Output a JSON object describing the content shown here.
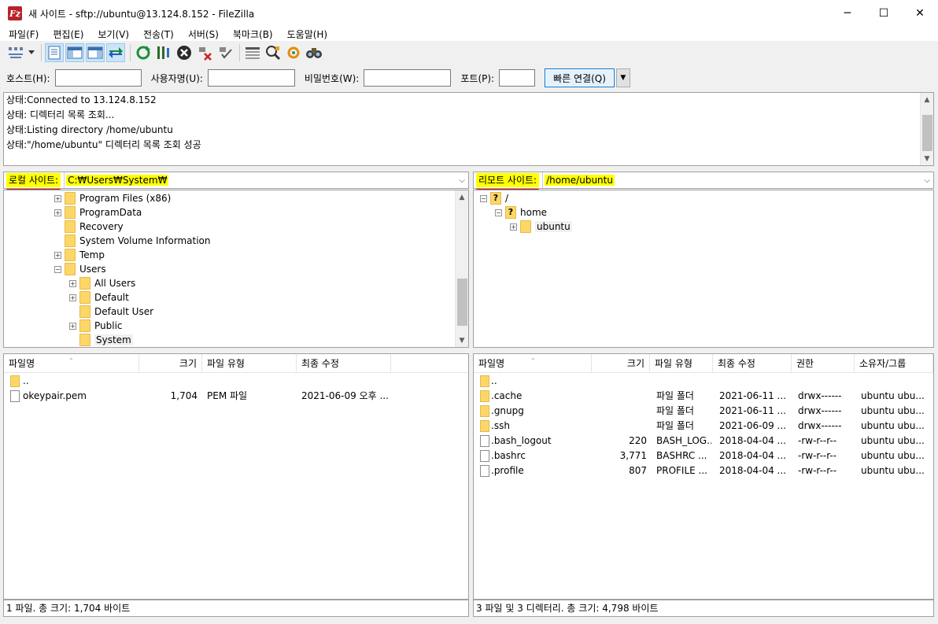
{
  "window": {
    "title": "새 사이트 - sftp://ubuntu@13.124.8.152 - FileZilla",
    "app_icon_text": "Fz",
    "controls": {
      "minimize": "─",
      "maximize": "☐",
      "close": "✕"
    }
  },
  "menu": [
    "파일(F)",
    "편집(E)",
    "보기(V)",
    "전송(T)",
    "서버(S)",
    "북마크(B)",
    "도움말(H)"
  ],
  "toolbar": {
    "icons": [
      "site-manager-icon",
      "dropdown-arrow-icon",
      "toggle-message-log-icon",
      "toggle-local-tree-icon",
      "toggle-remote-tree-icon",
      "toggle-transfer-queue-icon",
      "refresh-icon",
      "process-queue-icon",
      "cancel-icon",
      "disconnect-icon",
      "reconnect-icon",
      "directory-filter-icon",
      "compare-icon",
      "sync-browse-icon",
      "search-icon"
    ]
  },
  "quickconnect": {
    "host_label": "호스트(H):",
    "user_label": "사용자명(U):",
    "pass_label": "비밀번호(W):",
    "port_label": "포트(P):",
    "host_value": "",
    "user_value": "",
    "pass_value": "",
    "port_value": "",
    "connect_label": "빠른 연결(Q)"
  },
  "log": [
    {
      "prefix": "상태:",
      "text": "Connected to 13.124.8.152"
    },
    {
      "prefix": "상태:",
      "text": "디렉터리 목록 조회..."
    },
    {
      "prefix": "상태:",
      "text": "Listing directory /home/ubuntu"
    },
    {
      "prefix": "상태:",
      "text": "\"/home/ubuntu\" 디렉터리 목록 조회 성공"
    }
  ],
  "local": {
    "label": "로컬 사이트:",
    "path": "C:₩Users₩System₩",
    "tree": [
      {
        "name": "Program Files (x86)",
        "expander": "+"
      },
      {
        "name": "ProgramData",
        "expander": "+"
      },
      {
        "name": "Recovery",
        "expander": ""
      },
      {
        "name": "System Volume Information",
        "expander": ""
      },
      {
        "name": "Temp",
        "expander": "+"
      },
      {
        "name": "Users",
        "expander": "−"
      },
      {
        "name": "All Users",
        "expander": "+"
      },
      {
        "name": "Default",
        "expander": "+"
      },
      {
        "name": "Default User",
        "expander": ""
      },
      {
        "name": "Public",
        "expander": "+"
      },
      {
        "name": "System",
        "expander": ""
      }
    ],
    "columns": [
      "파일명",
      "크기",
      "파일 유형",
      "최종 수정"
    ],
    "files": [
      {
        "name": "..",
        "size": "",
        "type": "",
        "modified": "",
        "kind": "folder"
      },
      {
        "name": "okeypair.pem",
        "size": "1,704",
        "type": "PEM 파일",
        "modified": "2021-06-09 오후 ...",
        "kind": "file"
      }
    ],
    "status": "1 파일. 총 크기: 1,704 바이트"
  },
  "remote": {
    "label": "리모트 사이트:",
    "path": "/home/ubuntu",
    "tree": [
      {
        "name": "/",
        "expander": "−"
      },
      {
        "name": "home",
        "expander": "−"
      },
      {
        "name": "ubuntu",
        "expander": "+"
      }
    ],
    "columns": [
      "파일명",
      "크기",
      "파일 유형",
      "최종 수정",
      "권한",
      "소유자/그룹"
    ],
    "files": [
      {
        "name": "..",
        "size": "",
        "type": "",
        "modified": "",
        "perm": "",
        "owner": "",
        "kind": "folder"
      },
      {
        "name": ".cache",
        "size": "",
        "type": "파일 폴더",
        "modified": "2021-06-11 ...",
        "perm": "drwx------",
        "owner": "ubuntu ubu...",
        "kind": "folder"
      },
      {
        "name": ".gnupg",
        "size": "",
        "type": "파일 폴더",
        "modified": "2021-06-11 ...",
        "perm": "drwx------",
        "owner": "ubuntu ubu...",
        "kind": "folder"
      },
      {
        "name": ".ssh",
        "size": "",
        "type": "파일 폴더",
        "modified": "2021-06-09 ...",
        "perm": "drwx------",
        "owner": "ubuntu ubu...",
        "kind": "folder"
      },
      {
        "name": ".bash_logout",
        "size": "220",
        "type": "BASH_LOG...",
        "modified": "2018-04-04 ...",
        "perm": "-rw-r--r--",
        "owner": "ubuntu ubu...",
        "kind": "file"
      },
      {
        "name": ".bashrc",
        "size": "3,771",
        "type": "BASHRC ...",
        "modified": "2018-04-04 ...",
        "perm": "-rw-r--r--",
        "owner": "ubuntu ubu...",
        "kind": "file"
      },
      {
        "name": ".profile",
        "size": "807",
        "type": "PROFILE ...",
        "modified": "2018-04-04 ...",
        "perm": "-rw-r--r--",
        "owner": "ubuntu ubu...",
        "kind": "file"
      }
    ],
    "status": "3 파일 및 3 디렉터리. 총 크기: 4,798 바이트"
  },
  "colors": {
    "highlight": "#ffff00",
    "annotation_underline": "#e01010",
    "accent": "#0078d7"
  }
}
